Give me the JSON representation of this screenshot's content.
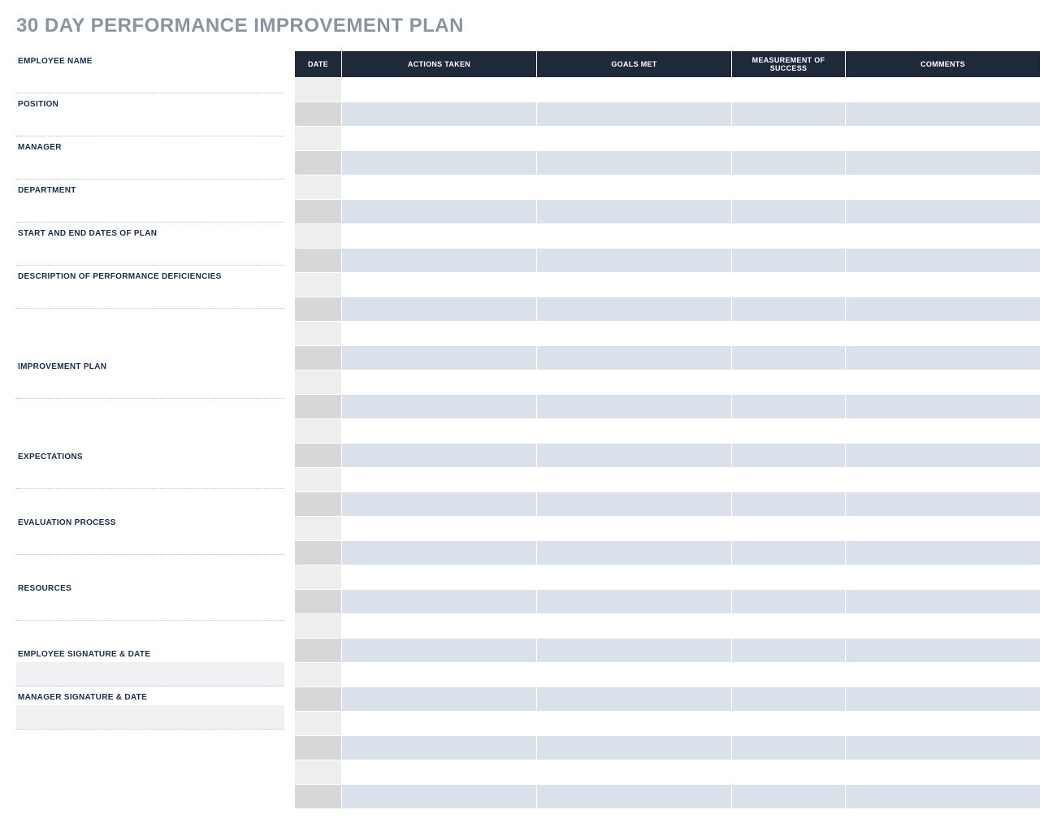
{
  "title": "30 DAY PERFORMANCE IMPROVEMENT PLAN",
  "info": {
    "employee_name": "EMPLOYEE NAME",
    "position": "POSITION",
    "manager": "MANAGER",
    "department": "DEPARTMENT",
    "dates": "START AND END DATES OF PLAN",
    "deficiencies": "DESCRIPTION OF PERFORMANCE DEFICIENCIES",
    "plan": "IMPROVEMENT PLAN",
    "expectations": "EXPECTATIONS",
    "evaluation": "EVALUATION PROCESS",
    "resources": "RESOURCES",
    "emp_sig": "EMPLOYEE SIGNATURE & DATE",
    "mgr_sig": "MANAGER SIGNATURE & DATE"
  },
  "table": {
    "headers": {
      "date": "DATE",
      "actions": "ACTIONS TAKEN",
      "goals": "GOALS MET",
      "measure": "MEASUREMENT OF SUCCESS",
      "comments": "COMMENTS"
    },
    "row_count": 30
  }
}
